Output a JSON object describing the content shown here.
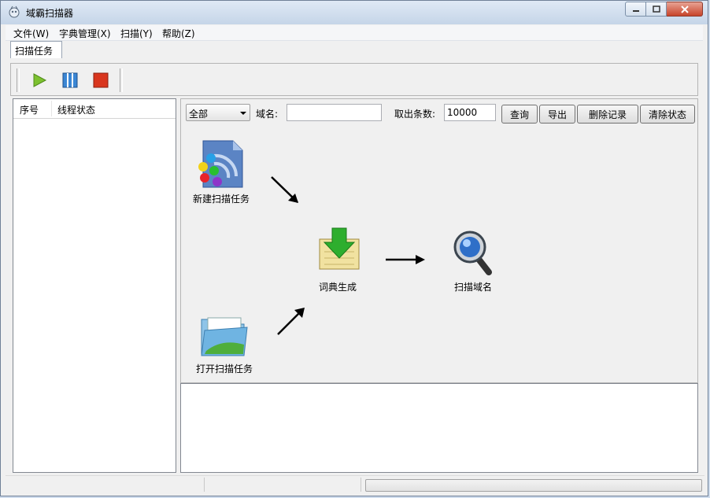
{
  "window": {
    "title": "域霸扫描器"
  },
  "menu": [
    "文件(W)",
    "字典管理(X)",
    "扫描(Y)",
    "帮助(Z)"
  ],
  "tab": {
    "label": "扫描任务"
  },
  "toolbar": {
    "start": "play-icon",
    "pause": "pause-icon",
    "stop": "stop-icon"
  },
  "list": {
    "columns": [
      "序号",
      "线程状态"
    ]
  },
  "filter": {
    "selected": "全部",
    "domain_label": "域名:",
    "domain_value": "",
    "count_label": "取出条数:",
    "count_value": "10000",
    "buttons": [
      "查询",
      "导出",
      "删除记录",
      "清除状态"
    ]
  },
  "flow": {
    "new_task": "新建扫描任务",
    "open_task": "打开扫描任务",
    "dict_gen": "词典生成",
    "scan_domain": "扫描域名"
  },
  "colors": {
    "play": "#7cc12f",
    "pause": "#3a86d4",
    "stop": "#d9361e",
    "close": "#c7442b"
  }
}
